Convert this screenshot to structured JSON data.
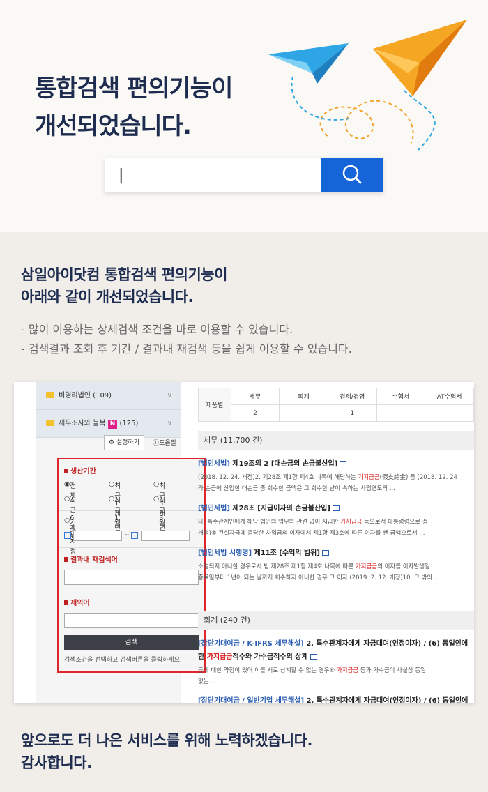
{
  "hero": {
    "title_line1": "통합검색 편의기능이",
    "title_line2": "개선되었습니다.",
    "search_value": "|",
    "accent_color": "#1565d8"
  },
  "intro": {
    "title_line1": "삼일아이닷컴 통합검색 편의기능이",
    "title_line2": "아래와 같이 개선되었습니다.",
    "bullets": [
      "- 많이 이용하는 상세검색 조건을 바로 이용할 수 있습니다.",
      "- 검색결과 조회 후 기간 / 결과내 재검색 등을 쉽게 이용할 수 있습니다."
    ]
  },
  "screenshot": {
    "left_panel": {
      "items": [
        {
          "label": "비영리법인 (109)"
        },
        {
          "label": "세무조사와 불복",
          "badge": "N",
          "count": "(125)"
        }
      ],
      "settings_label": "설정하기",
      "help_label": "도움말",
      "filter": {
        "period_title": "생산기간",
        "options": [
          "전체",
          "최근1개월",
          "최근3개월",
          "최근6개월",
          "최근1년",
          "최근3년",
          "기간지정"
        ],
        "date_sep": "~",
        "research_title": "결과내 재검색어",
        "exclude_title": "제외어",
        "search_button": "검색",
        "hint": "검색조건을 선택하고 검색버튼을 클릭하세요."
      }
    },
    "right_panel": {
      "table": {
        "row_header": "제품별",
        "columns": [
          "세무",
          "회계",
          "경제/경영",
          "수험서",
          "AT수험서"
        ],
        "counts": [
          "2",
          "",
          "1",
          "",
          ""
        ]
      },
      "sections": [
        {
          "title": "세무 (11,700 건)",
          "results": [
            {
              "cat": "[법인세법]",
              "title": " 제19조의 2 [대손금의 손금불산입]",
              "line1_a": "(2018. 12. 24. 개정)2. 제28조 제1항 제4호 나목에 해당하는 ",
              "line1_hl": "가지급금",
              "line1_b": "(假支給金) 등 (2018. 12. 24",
              "line2": "라 손금에 산입한 대손금 중 회수한 금액은 그 회수한 날이 속하는 사업연도의 ..."
            },
            {
              "cat": "[법인세법]",
              "title": " 제28조 [지급이자의 손금불산입]",
              "line1_a": "나. 특수관계인에게 해당 법인의 업무와 관련 없이 지급한 ",
              "line1_hl": "가지급금",
              "line1_b": " 등으로서 대통령령으로 정",
              "line2": "개정)⑥ 건설자금에 충당한 차입금의 이자에서 제1항 제3호에 따른 이자를 뺀 금액으로서 ..."
            },
            {
              "cat": "[법인세법 시행령]",
              "title": " 제11조 [수익의 범위]",
              "line1_a": "소멸되지 아니한 경우로서 법 제28조 제1항 제4호 나목에 따른 ",
              "line1_hl": "가지급금",
              "line1_b": "의 이자를 이자발생일",
              "line2": "종료일부터 1년이 되는 날까지 회수하지 아니한 경우 그 이자 (2019. 2. 12. 개정)10. 그 밖의 ..."
            }
          ]
        },
        {
          "title": "회계 (240 건)",
          "results": [
            {
              "cat": "[장단기대여금 / K-IFRS 세무해설]",
              "title": " 2. 특수관계자에게 자금대여(인정이자) / (6) 동일인에",
              "title2_a": "한 ",
              "title2_hl": "가지급금",
              "title2_b": "적수와 가수금적수의 상계",
              "line1_a": "등에 대한 약정이 있어 이를 서로 상계할 수 없는 경우⑥ ",
              "line1_hl": "가지급금",
              "line1_b": " 등과 가수금이 사실상 동일",
              "line2": "없는 ..."
            },
            {
              "cat": "[장단기대여금 / 일반기업 세무해설]",
              "title": " 2. 특수관계자에게 자금대여(인정이자) / (6) 동일인에"
            }
          ]
        }
      ]
    }
  },
  "outro": {
    "line1": "앞으로도 더 나은 서비스를 위해 노력하겠습니다.",
    "line2": "감사합니다."
  }
}
